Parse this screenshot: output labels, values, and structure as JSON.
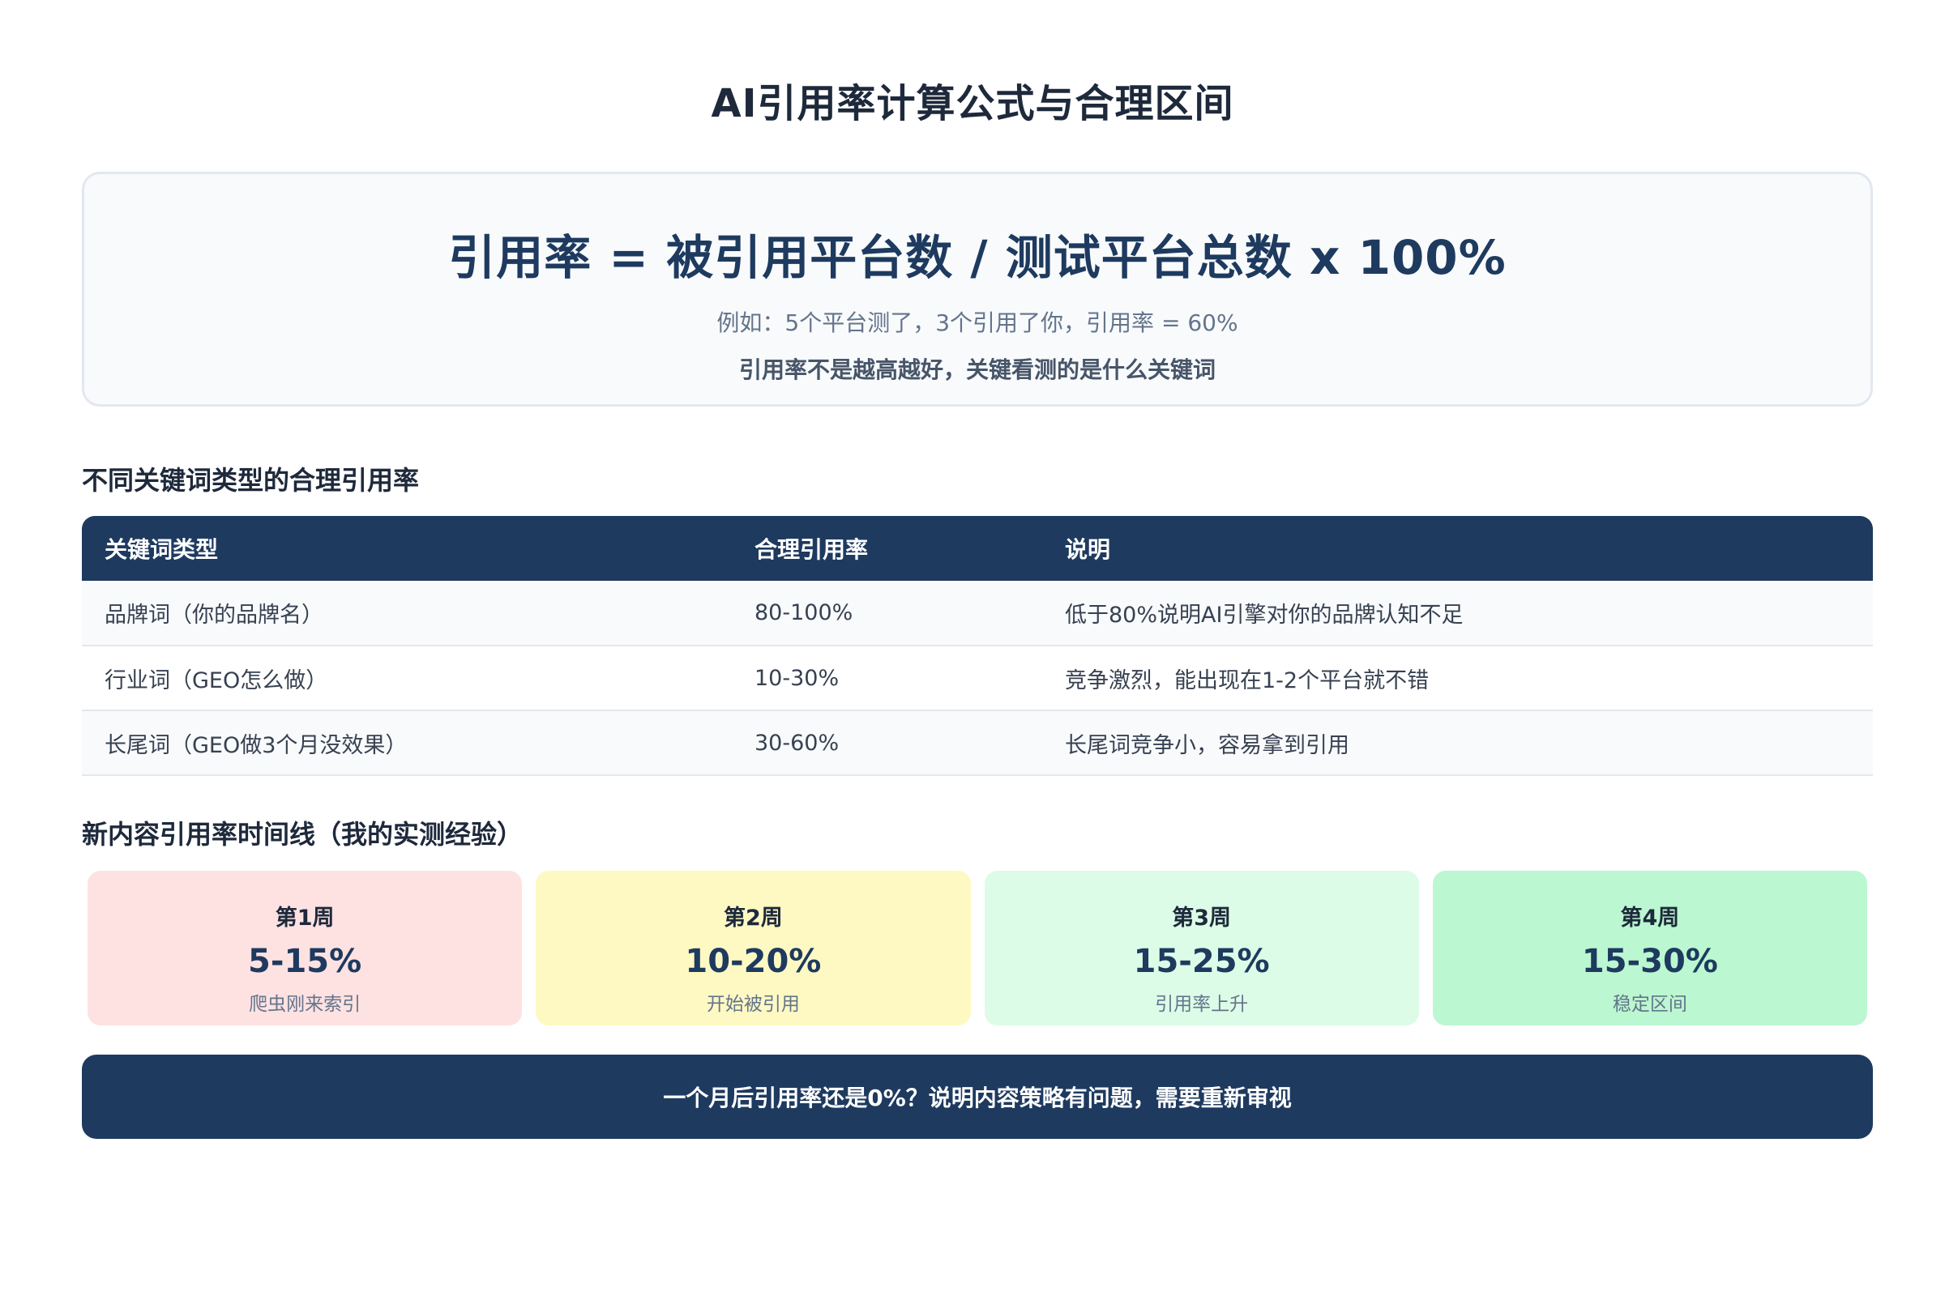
{
  "title": "AI引用率计算公式与合理区间",
  "formula": {
    "main": "引用率 = 被引用平台数 / 测试平台总数 x 100%",
    "example": "例如：5个平台测了，3个引用了你，引用率 = 60%",
    "note": "引用率不是越高越好，关键看测的是什么关键词"
  },
  "keyword_section": {
    "title": "不同关键词类型的合理引用率",
    "headers": [
      "关键词类型",
      "合理引用率",
      "说明"
    ],
    "rows": [
      [
        "品牌词（你的品牌名）",
        "80-100%",
        "低于80%说明AI引擎对你的品牌认知不足"
      ],
      [
        "行业词（GEO怎么做）",
        "10-30%",
        "竞争激烈，能出现在1-2个平台就不错"
      ],
      [
        "长尾词（GEO做3个月没效果）",
        "30-60%",
        "长尾词竞争小，容易拿到引用"
      ]
    ]
  },
  "timeline_section": {
    "title": "新内容引用率时间线（我的实测经验）",
    "weeks": [
      {
        "label": "第1周",
        "rate": "5-15%",
        "desc": "爬虫刚来索引",
        "color": "#fee2e2"
      },
      {
        "label": "第2周",
        "rate": "10-20%",
        "desc": "开始被引用",
        "color": "#fef9c3"
      },
      {
        "label": "第3周",
        "rate": "15-25%",
        "desc": "引用率上升",
        "color": "#dcfce7"
      },
      {
        "label": "第4周",
        "rate": "15-30%",
        "desc": "稳定区间",
        "color": "#bbf7d0"
      }
    ]
  },
  "banner": "一个月后引用率还是0%？说明内容策略有问题，需要重新审视",
  "colors": {
    "primary": "#1e3a5f",
    "card_bg": "#f8fafc",
    "border": "#e2e8f0"
  }
}
